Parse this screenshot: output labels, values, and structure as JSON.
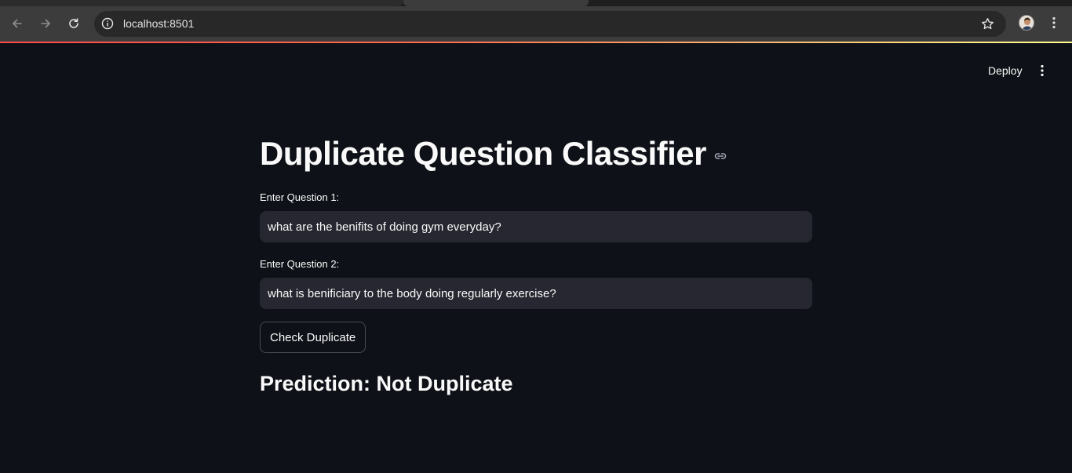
{
  "browser": {
    "url": "localhost:8501"
  },
  "app": {
    "deploy_label": "Deploy",
    "title": "Duplicate Question Classifier",
    "question1": {
      "label": "Enter Question 1:",
      "value": "what are the benifits of doing gym everyday?"
    },
    "question2": {
      "label": "Enter Question 2:",
      "value": "what is benificiary to the body doing regularly exercise?"
    },
    "check_button_label": "Check Duplicate",
    "prediction_text": "Prediction: Not Duplicate"
  },
  "icons": {
    "back": "arrow-left-icon",
    "forward": "arrow-right-icon",
    "reload": "reload-icon",
    "site_info": "info-icon",
    "bookmark": "star-icon",
    "profile": "avatar",
    "browser_menu": "kebab-menu-icon",
    "app_menu": "kebab-menu-icon",
    "anchor": "link-icon"
  },
  "colors": {
    "app_background": "#0e1117",
    "input_background": "#262730",
    "accent_gradient_start": "#ff4b4b",
    "accent_gradient_end": "#fdff8f"
  }
}
